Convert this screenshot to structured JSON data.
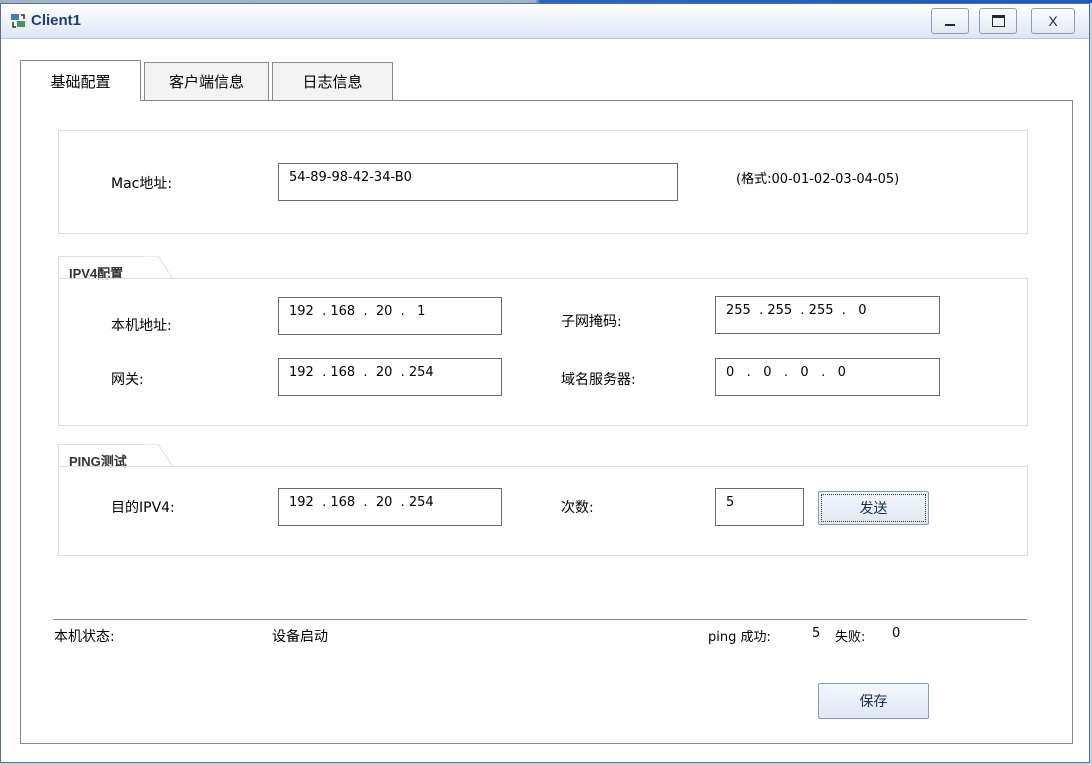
{
  "window": {
    "title": "Client1"
  },
  "window_controls": {
    "minimize_icon": "minimize-icon",
    "maximize_icon": "maximize-icon",
    "close_label": "X"
  },
  "tabs": [
    {
      "label": "基础配置",
      "active": true
    },
    {
      "label": "客户端信息",
      "active": false
    },
    {
      "label": "日志信息",
      "active": false
    }
  ],
  "mac": {
    "label": "Mac地址:",
    "value": "54-89-98-42-34-B0",
    "hint": "(格式:00-01-02-03-04-05)"
  },
  "ipv4": {
    "legend": "IPV4配置",
    "local_ip": {
      "label": "本机地址:",
      "value": "192  . 168  .  20  .   1"
    },
    "subnet": {
      "label": "子网掩码:",
      "value": "255  . 255  . 255  .   0"
    },
    "gateway": {
      "label": "网关:",
      "value": "192  . 168  .  20  . 254"
    },
    "dns": {
      "label": "域名服务器:",
      "value": "0   .   0   .   0   .   0"
    }
  },
  "ping": {
    "legend": "PING测试",
    "target": {
      "label": "目的IPV4:",
      "value": "192  . 168  .  20  . 254"
    },
    "count": {
      "label": "次数:",
      "value": "5"
    },
    "send_label": "发送"
  },
  "status": {
    "label": "本机状态:",
    "value": "设备启动",
    "ping_success_label": "ping 成功:",
    "ping_success_value": "5",
    "ping_fail_label": "失败:",
    "ping_fail_value": "0"
  },
  "save_label": "保存",
  "colors": {
    "title_text": "#1c3e7a",
    "button_bg": "#dfe7f3",
    "window_border": "#5d6f88"
  }
}
